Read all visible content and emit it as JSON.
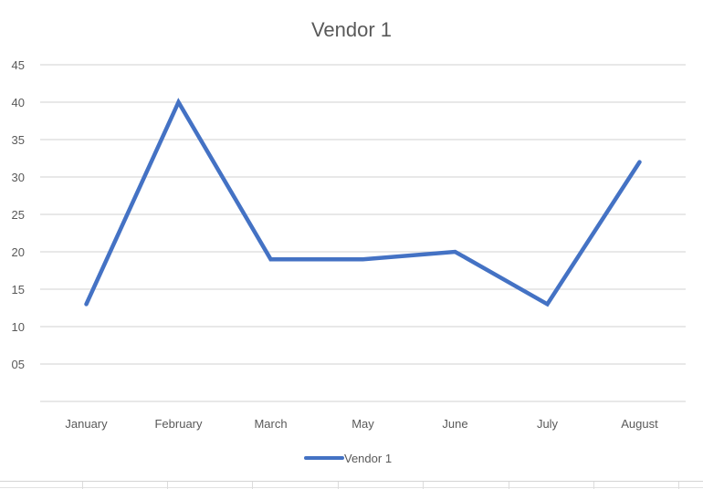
{
  "chart_data": {
    "type": "line",
    "title": "Vendor 1",
    "xlabel": "",
    "ylabel": "",
    "categories": [
      "January",
      "February",
      "March",
      "May",
      "June",
      "July",
      "August"
    ],
    "series": [
      {
        "name": "Vendor 1",
        "values": [
          13,
          40,
          19,
          19,
          20,
          13,
          32
        ],
        "color": "#4472C4"
      }
    ],
    "ylim": [
      0,
      45
    ],
    "yticks": [
      {
        "value": 5,
        "label": "05"
      },
      {
        "value": 10,
        "label": "10"
      },
      {
        "value": 15,
        "label": "15"
      },
      {
        "value": 20,
        "label": "20"
      },
      {
        "value": 25,
        "label": "25"
      },
      {
        "value": 30,
        "label": "30"
      },
      {
        "value": 35,
        "label": "35"
      },
      {
        "value": 40,
        "label": "40"
      },
      {
        "value": 45,
        "label": "45"
      }
    ],
    "grid": true,
    "legend": {
      "position": "bottom",
      "entries": [
        "Vendor 1"
      ]
    }
  }
}
